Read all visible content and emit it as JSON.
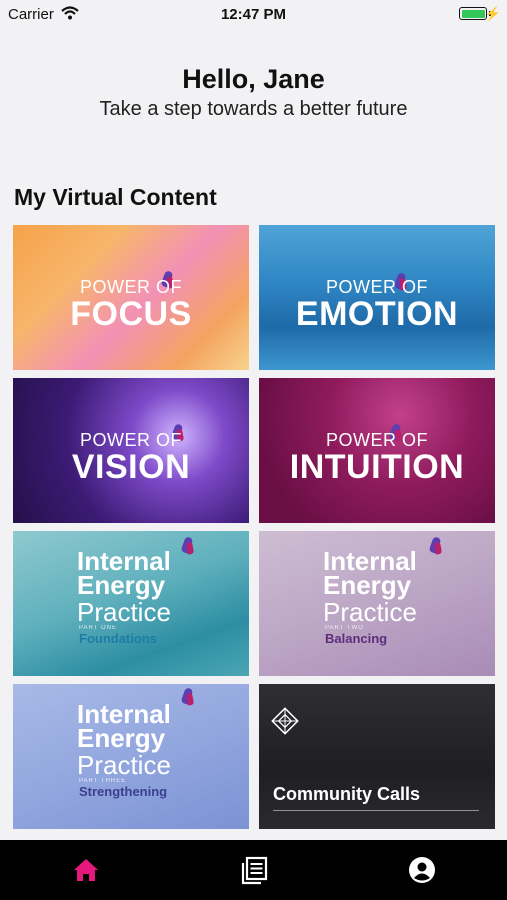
{
  "status": {
    "carrier": "Carrier",
    "time": "12:47 PM",
    "battery_level": 1.0
  },
  "header": {
    "greeting": "Hello, Jane",
    "tagline": "Take a step towards a better future"
  },
  "section": {
    "title": "My Virtual Content"
  },
  "cards": [
    {
      "line1": "POWER OF",
      "line2": "FOCUS"
    },
    {
      "line1": "POWER OF",
      "line2": "EMOTION"
    },
    {
      "line1": "POWER OF",
      "line2": "VISION"
    },
    {
      "line1": "POWER OF",
      "line2": "INTUITION"
    },
    {
      "l1": "Internal",
      "l2": "Energy",
      "l3": "Practice",
      "part": "PART ONE",
      "sub": "Foundations"
    },
    {
      "l1": "Internal",
      "l2": "Energy",
      "l3": "Practice",
      "part": "PART TWO",
      "sub": "Balancing"
    },
    {
      "l1": "Internal",
      "l2": "Energy",
      "l3": "Practice",
      "part": "PART THREE",
      "sub": "Strengthening"
    },
    {
      "title": "Community Calls"
    }
  ],
  "tabs": [
    {
      "icon": "home-icon",
      "color": "#e6187d"
    },
    {
      "icon": "library-icon",
      "color": "#ffffff"
    },
    {
      "icon": "profile-icon",
      "color": "#ffffff"
    }
  ]
}
